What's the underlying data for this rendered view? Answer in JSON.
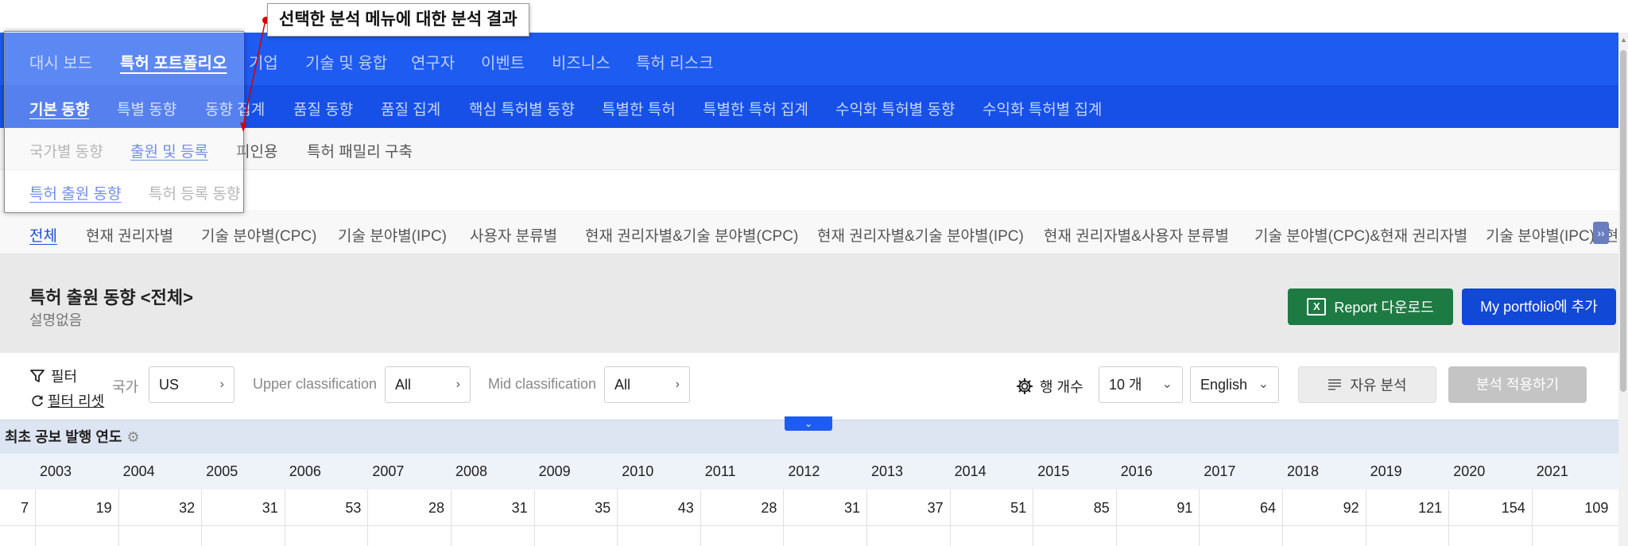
{
  "callout": {
    "text": "선택한 분석 메뉴에 대한 분석 결과"
  },
  "nav1": {
    "items": [
      "대시 보드",
      "특허 포트폴리오",
      "기업",
      "기술 및 융합",
      "연구자",
      "이벤트",
      "비즈니스",
      "특허 리스크"
    ]
  },
  "nav2": {
    "items": [
      "기본 동향",
      "특별 동향",
      "동향 집계",
      "품질 동향",
      "품질 집계",
      "핵심 특허별 동향",
      "특별한 특허",
      "특별한 특허 집계",
      "수익화 특허별 동향",
      "수익화 특허별 집계"
    ]
  },
  "nav3": {
    "items": [
      "국가별 동향",
      "출원 및 등록",
      "피인용",
      "특허 패밀리 구축"
    ]
  },
  "nav4": {
    "items": [
      "특허 출원 동향",
      "특허 등록 동향"
    ]
  },
  "nav5": {
    "items": [
      "전체",
      "현재 권리자별",
      "기술 분야별(CPC)",
      "기술 분야별(IPC)",
      "사용자 분류별",
      "현재 권리자별&기술 분야별(CPC)",
      "현재 권리자별&기술 분야별(IPC)",
      "현재 권리자별&사용자 분류별",
      "기술 분야별(CPC)&현재 권리자별",
      "기술 분야별(IPC)&현재 권"
    ],
    "scroll_icon": "chevron-right-icon"
  },
  "header": {
    "title": "특허 출원 동향 <전체>",
    "subtitle": "설명없음",
    "report_button": "Report 다운로드",
    "report_icon_text": "X",
    "portfolio_button": "My portfolio에 추가"
  },
  "filters": {
    "filter_label": "필터",
    "reset_label": "필터 리셋",
    "country_label": "국가",
    "country_value": "US",
    "upper_label": "Upper classification",
    "upper_value": "All",
    "mid_label": "Mid classification",
    "mid_value": "All",
    "rows_label": "행 개수",
    "rows_value": "10 개",
    "language_value": "English",
    "free_analysis_button": "자유 분석",
    "apply_button": "분석 적용하기"
  },
  "table": {
    "caption": "최초 공보 발행 연도",
    "years": [
      "2003",
      "2004",
      "2005",
      "2006",
      "2007",
      "2008",
      "2009",
      "2010",
      "2011",
      "2012",
      "2013",
      "2014",
      "2015",
      "2016",
      "2017",
      "2018",
      "2019",
      "2020",
      "2021"
    ],
    "values": [
      "7",
      "19",
      "32",
      "31",
      "53",
      "28",
      "31",
      "35",
      "43",
      "28",
      "31",
      "37",
      "51",
      "85",
      "91",
      "64",
      "92",
      "121",
      "154",
      "109"
    ]
  },
  "colors": {
    "nav_primary": "#1e5bf0",
    "nav_secondary": "#1650e6",
    "report_green": "#1e7a43",
    "portfolio_blue": "#1248d6",
    "callout_marker": "#d40000"
  }
}
